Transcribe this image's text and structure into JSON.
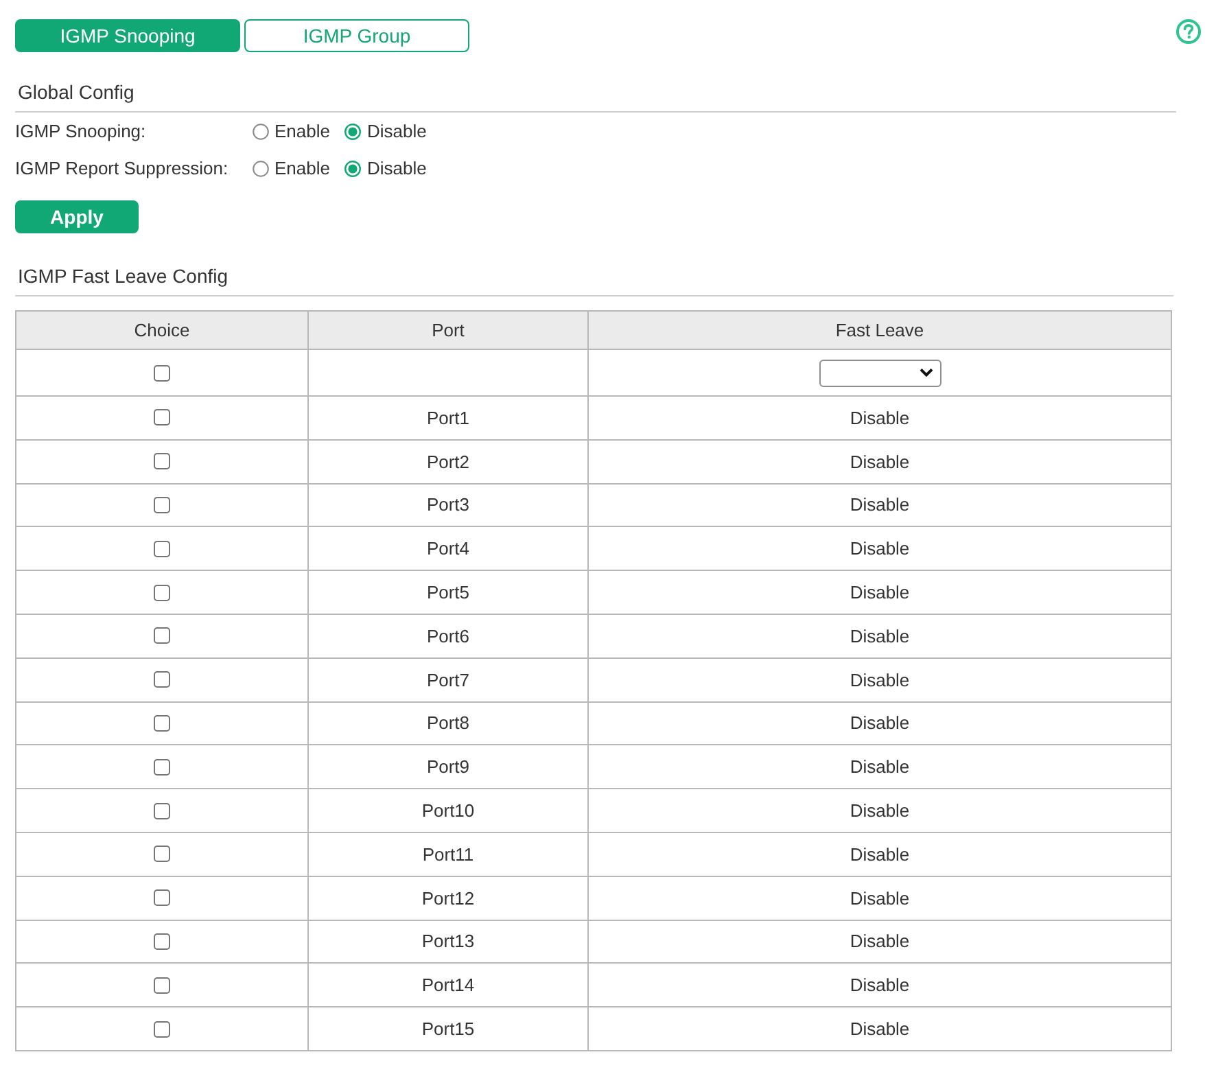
{
  "tabs": [
    {
      "label": "IGMP Snooping",
      "selected": true
    },
    {
      "label": "IGMP Group",
      "selected": false
    }
  ],
  "global_config": {
    "title": "Global Config",
    "settings": [
      {
        "label": "IGMP Snooping:",
        "options": [
          {
            "label": "Enable",
            "selected": false
          },
          {
            "label": "Disable",
            "selected": true
          }
        ]
      },
      {
        "label": "IGMP Report Suppression:",
        "options": [
          {
            "label": "Enable",
            "selected": false
          },
          {
            "label": "Disable",
            "selected": true
          }
        ]
      }
    ],
    "apply_button": "Apply"
  },
  "fast_leave_config": {
    "title": "IGMP Fast Leave Config",
    "table": {
      "columns": [
        "Choice",
        "Port",
        "Fast Leave"
      ],
      "filter_row": {
        "checked": false
      },
      "rows": [
        {
          "checked": false,
          "port": "Port1",
          "fast_leave": "Disable"
        },
        {
          "checked": false,
          "port": "Port2",
          "fast_leave": "Disable"
        },
        {
          "checked": false,
          "port": "Port3",
          "fast_leave": "Disable"
        },
        {
          "checked": false,
          "port": "Port4",
          "fast_leave": "Disable"
        },
        {
          "checked": false,
          "port": "Port5",
          "fast_leave": "Disable"
        },
        {
          "checked": false,
          "port": "Port6",
          "fast_leave": "Disable"
        },
        {
          "checked": false,
          "port": "Port7",
          "fast_leave": "Disable"
        },
        {
          "checked": false,
          "port": "Port8",
          "fast_leave": "Disable"
        },
        {
          "checked": false,
          "port": "Port9",
          "fast_leave": "Disable"
        },
        {
          "checked": false,
          "port": "Port10",
          "fast_leave": "Disable"
        },
        {
          "checked": false,
          "port": "Port11",
          "fast_leave": "Disable"
        },
        {
          "checked": false,
          "port": "Port12",
          "fast_leave": "Disable"
        },
        {
          "checked": false,
          "port": "Port13",
          "fast_leave": "Disable"
        },
        {
          "checked": false,
          "port": "Port14",
          "fast_leave": "Disable"
        },
        {
          "checked": false,
          "port": "Port15",
          "fast_leave": "Disable"
        }
      ]
    }
  }
}
